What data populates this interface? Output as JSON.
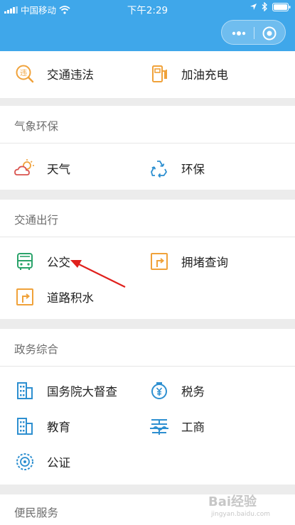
{
  "status_bar": {
    "carrier": "中国移动",
    "time": "下午2:29"
  },
  "sections": {
    "top": {
      "items": [
        {
          "label": "交通违法"
        },
        {
          "label": "加油充电"
        }
      ]
    },
    "weather": {
      "title": "气象环保",
      "items": [
        {
          "label": "天气"
        },
        {
          "label": "环保"
        }
      ]
    },
    "traffic": {
      "title": "交通出行",
      "items": [
        {
          "label": "公交"
        },
        {
          "label": "拥堵查询"
        },
        {
          "label": "道路积水"
        }
      ]
    },
    "gov": {
      "title": "政务综合",
      "items": [
        {
          "label": "国务院大督查"
        },
        {
          "label": "税务"
        },
        {
          "label": "教育"
        },
        {
          "label": "工商"
        },
        {
          "label": "公证"
        }
      ]
    },
    "service": {
      "title": "便民服务"
    }
  },
  "watermark": {
    "text": "Bai经验",
    "sub": "jingyan.baidu.com"
  },
  "colors": {
    "header": "#3fa7ea",
    "orange": "#f0a23a",
    "blue": "#2d8fd0",
    "green": "#2aa36a",
    "red": "#d9534f"
  }
}
